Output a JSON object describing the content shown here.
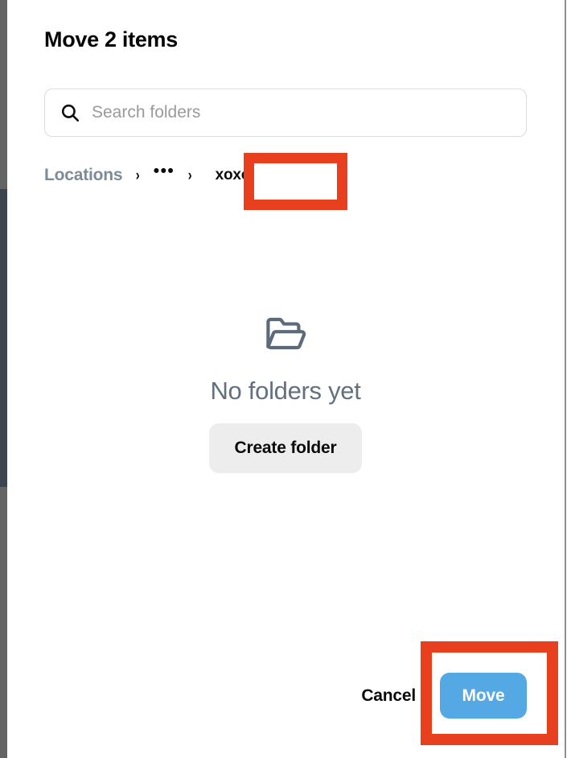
{
  "dialog": {
    "title": "Move 2 items"
  },
  "search": {
    "placeholder": "Search folders",
    "value": "",
    "icon": "search-icon"
  },
  "breadcrumb": {
    "root_label": "Locations",
    "separator": "›",
    "ellipsis": "•••",
    "current_label": "xoxo"
  },
  "empty_state": {
    "icon": "open-folder-icon",
    "title": "No folders yet",
    "create_button_label": "Create folder"
  },
  "footer": {
    "cancel_label": "Cancel",
    "move_label": "Move"
  },
  "colors": {
    "annotation_red": "#e8401f",
    "move_button_blue": "#54a8e4",
    "empty_text_slate": "#62707f",
    "breadcrumb_root_gray": "#7d8a99",
    "create_button_gray": "#ededed",
    "background_strip_gray": "#646464",
    "background_strip_navy": "#3b444f"
  }
}
